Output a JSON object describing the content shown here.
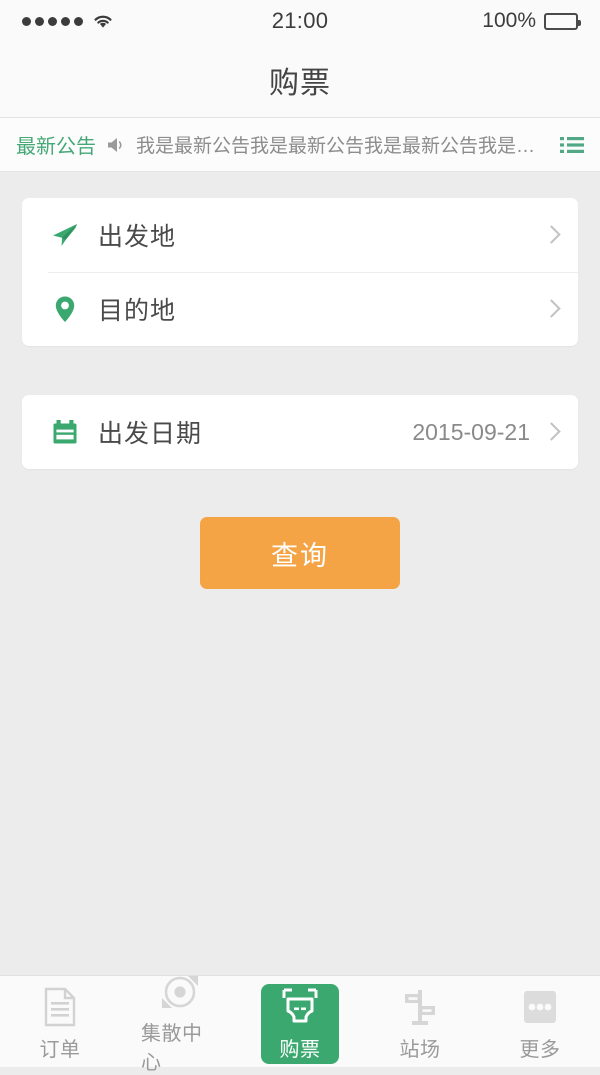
{
  "status_bar": {
    "signal_dots": 5,
    "wifi_icon": "wifi-icon",
    "time": "21:00",
    "battery_percent": "100%",
    "battery_icon": "battery-full-icon"
  },
  "nav": {
    "title": "购票"
  },
  "announcement": {
    "label": "最新公告",
    "speaker_icon": "speaker-icon",
    "text": "我是最新公告我是最新公告我是最新公告我是最新公...",
    "list_icon": "list-icon"
  },
  "form": {
    "rows": [
      {
        "icon": "send-plane-icon",
        "label": "出发地",
        "value": "",
        "chevron": "chevron-right-icon"
      },
      {
        "icon": "map-pin-icon",
        "label": "目的地",
        "value": "",
        "chevron": "chevron-right-icon"
      },
      {
        "icon": "calendar-icon",
        "label": "出发日期",
        "value": "2015-09-21",
        "chevron": "chevron-right-icon"
      }
    ],
    "search_label": "查询"
  },
  "tabs": [
    {
      "icon": "document-icon",
      "label": "订单",
      "active": false
    },
    {
      "icon": "target-circle-icon",
      "label": "集散中心",
      "active": false
    },
    {
      "icon": "ticket-icon",
      "label": "购票",
      "active": true
    },
    {
      "icon": "signpost-icon",
      "label": "站场",
      "active": false
    },
    {
      "icon": "more-dots-icon",
      "label": "更多",
      "active": false
    }
  ],
  "colors": {
    "brand_green": "#3ba96f",
    "accent_orange": "#f4a345",
    "background": "#ececec",
    "card": "#ffffff",
    "text_primary": "#4a4a4a",
    "text_secondary": "#8a8a8a"
  }
}
